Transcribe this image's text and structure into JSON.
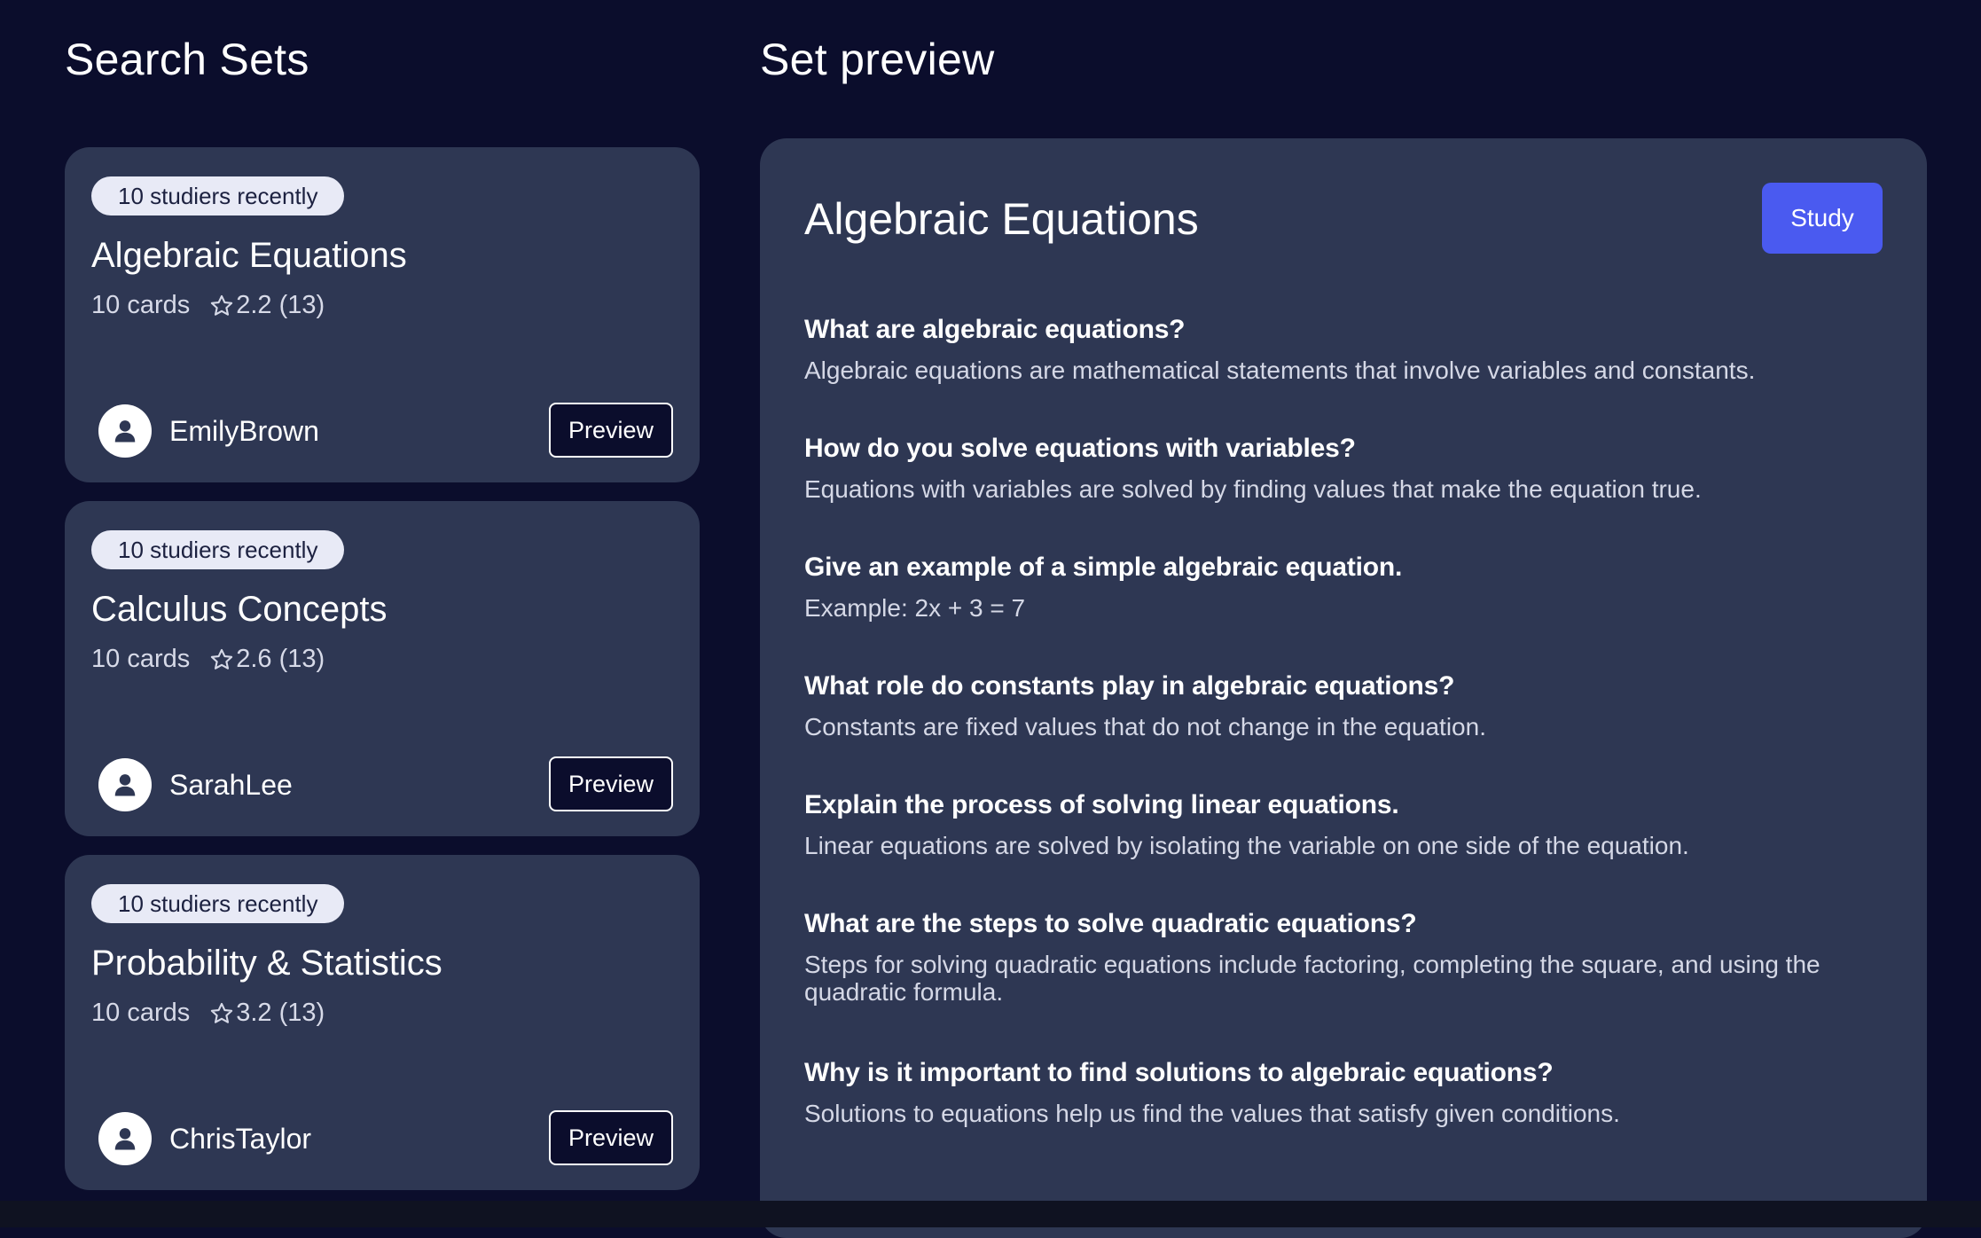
{
  "search": {
    "title": "Search Sets"
  },
  "sets": [
    {
      "studiers": "10 studiers recently",
      "title": "Algebraic Equations",
      "cards": "10 cards",
      "rating": "2.2 (13)",
      "author": "EmilyBrown",
      "preview_label": "Preview"
    },
    {
      "studiers": "10 studiers recently",
      "title": "Calculus Concepts",
      "cards": "10 cards",
      "rating": "2.6 (13)",
      "author": "SarahLee",
      "preview_label": "Preview"
    },
    {
      "studiers": "10 studiers recently",
      "title": "Probability & Statistics",
      "cards": "10 cards",
      "rating": "3.2 (13)",
      "author": "ChrisTaylor",
      "preview_label": "Preview"
    }
  ],
  "preview": {
    "section_title": "Set preview",
    "set_title": "Algebraic Equations",
    "study_label": "Study",
    "cards": [
      {
        "question": "What are algebraic equations?",
        "answer": "Algebraic equations are mathematical statements that involve variables and constants."
      },
      {
        "question": "How do you solve equations with variables?",
        "answer": "Equations with variables are solved by finding values that make the equation true."
      },
      {
        "question": "Give an example of a simple algebraic equation.",
        "answer": "Example: 2x + 3 = 7"
      },
      {
        "question": "What role do constants play in algebraic equations?",
        "answer": "Constants are fixed values that do not change in the equation."
      },
      {
        "question": "Explain the process of solving linear equations.",
        "answer": "Linear equations are solved by isolating the variable on one side of the equation."
      },
      {
        "question": "What are the steps to solve quadratic equations?",
        "answer": "Steps for solving quadratic equations include factoring, completing the square, and using the quadratic formula."
      },
      {
        "question": "Why is it important to find solutions to algebraic equations?",
        "answer": "Solutions to equations help us find the values that satisfy given conditions."
      }
    ]
  },
  "colors": {
    "background": "#0b0d2c",
    "card": "#2e3753",
    "accent": "#4a5af0",
    "badge": "#e8eaf6"
  },
  "icons": {
    "rating": "star-outline-icon",
    "author": "user-icon"
  }
}
